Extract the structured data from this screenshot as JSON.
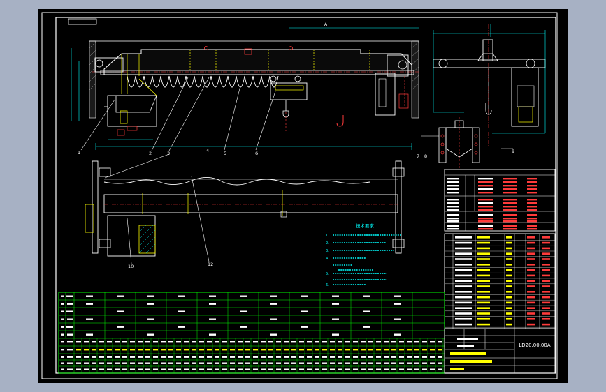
{
  "drawing": {
    "view_label": "A",
    "frame_tag": "",
    "drawing_no": "LD20.00.00A",
    "balloons": [
      "1",
      "2",
      "3",
      "4",
      "5",
      "6",
      "7",
      "8",
      "9",
      "10",
      "12"
    ],
    "notes_title": "技术要求",
    "notes": [
      "1.",
      "2.",
      "3.",
      "4.",
      "5.",
      "6."
    ]
  },
  "colors": {
    "background": "#000000",
    "viewport": "#a7b1c4",
    "white": "#ffffff",
    "yellow": "#ffff00",
    "red": "#ff3b3b",
    "green": "#00ff00",
    "cyan": "#00ffff",
    "blue": "#3c78ff",
    "magenta": "#ff40ff"
  }
}
